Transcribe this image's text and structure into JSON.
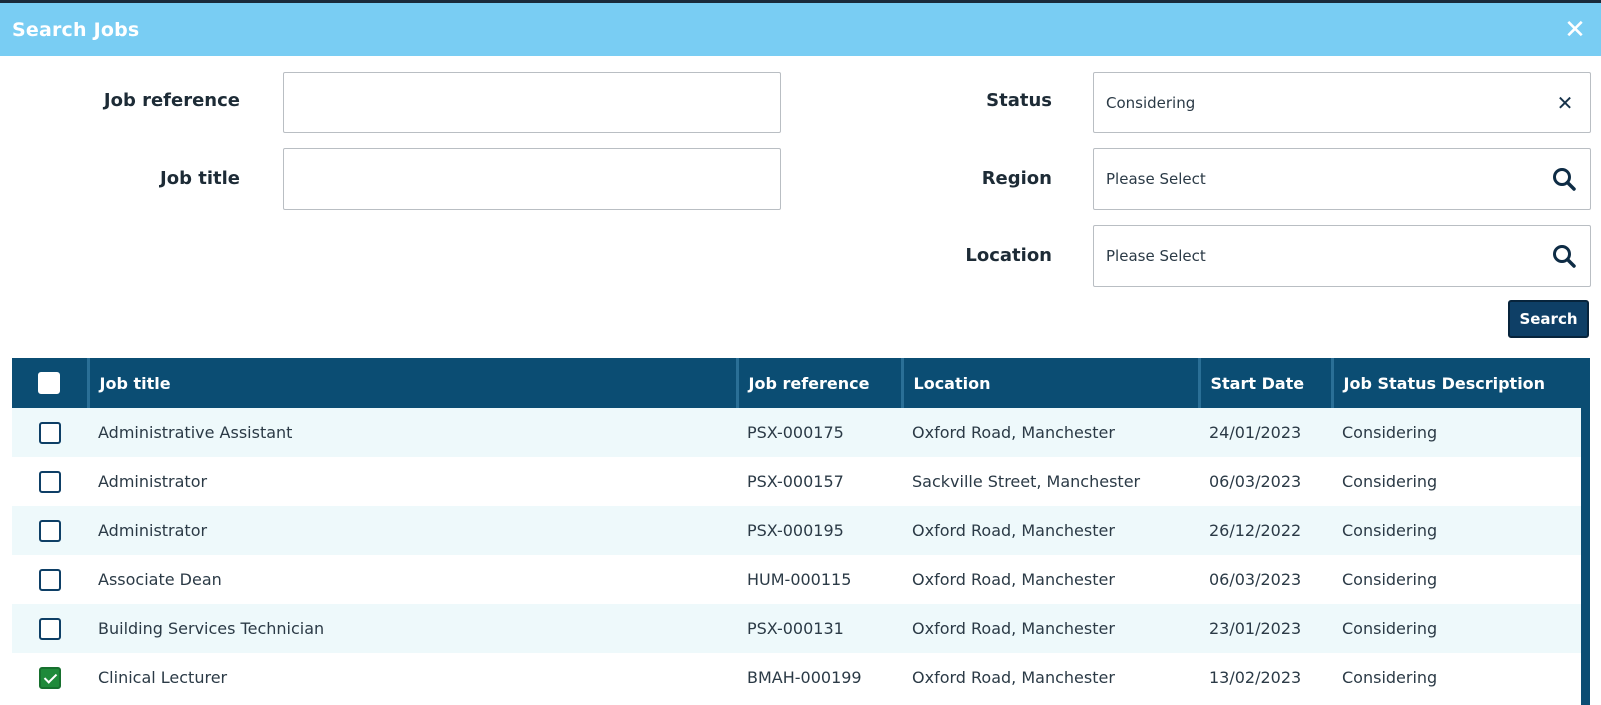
{
  "dialog": {
    "title": "Search Jobs",
    "close_symbol": "✕"
  },
  "form": {
    "job_reference_label": "Job reference",
    "job_reference_value": "",
    "job_title_label": "Job title",
    "job_title_value": "",
    "status_label": "Status",
    "status_value": "Considering",
    "region_label": "Region",
    "region_value": "Please Select",
    "location_label": "Location",
    "location_value": "Please Select",
    "clear_symbol": "✕",
    "search_button": "Search"
  },
  "table": {
    "columns": [
      "Job title",
      "Job reference",
      "Location",
      "Start Date",
      "Job Status Description"
    ],
    "rows": [
      {
        "checked": false,
        "job_title": "Administrative Assistant",
        "job_reference": "PSX-000175",
        "location": "Oxford Road, Manchester",
        "start_date": "24/01/2023",
        "status": "Considering"
      },
      {
        "checked": false,
        "job_title": "Administrator",
        "job_reference": "PSX-000157",
        "location": "Sackville Street, Manchester",
        "start_date": "06/03/2023",
        "status": "Considering"
      },
      {
        "checked": false,
        "job_title": "Administrator",
        "job_reference": "PSX-000195",
        "location": "Oxford Road, Manchester",
        "start_date": "26/12/2022",
        "status": "Considering"
      },
      {
        "checked": false,
        "job_title": "Associate Dean",
        "job_reference": "HUM-000115",
        "location": "Oxford Road, Manchester",
        "start_date": "06/03/2023",
        "status": "Considering"
      },
      {
        "checked": false,
        "job_title": "Building Services Technician",
        "job_reference": "PSX-000131",
        "location": "Oxford Road, Manchester",
        "start_date": "23/01/2023",
        "status": "Considering"
      },
      {
        "checked": true,
        "job_title": "Clinical Lecturer",
        "job_reference": "BMAH-000199",
        "location": "Oxford Road, Manchester",
        "start_date": "13/02/2023",
        "status": "Considering"
      }
    ]
  },
  "colors": {
    "titlebar": "#79cdf3",
    "table_header": "#0b4d73",
    "button": "#0e3f66",
    "checked": "#1f8a3a",
    "row_stripe": "#eef9fb"
  },
  "icons": {
    "close": "close-icon",
    "clear": "clear-icon",
    "search": "search-icon",
    "checkmark": "checkmark-icon"
  }
}
